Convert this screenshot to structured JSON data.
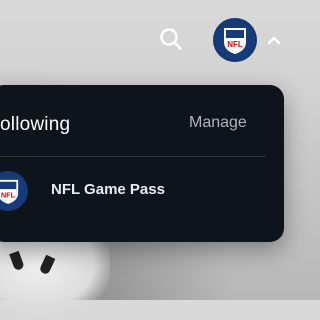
{
  "header": {
    "search_icon": "search-icon",
    "avatar_icon": "nfl-shield-icon",
    "avatar_text": "NFL",
    "toggle_icon": "chevron-up-icon"
  },
  "menu": {
    "title": "ollowing",
    "manage_label": "Manage",
    "items": [
      {
        "label": "NFL Game Pass",
        "icon": "nfl-shield-icon",
        "icon_text": "NFL"
      }
    ]
  },
  "colors": {
    "panel_bg": "#0e141b",
    "nfl_blue": "#173a78",
    "nfl_red": "#d50a0a"
  }
}
